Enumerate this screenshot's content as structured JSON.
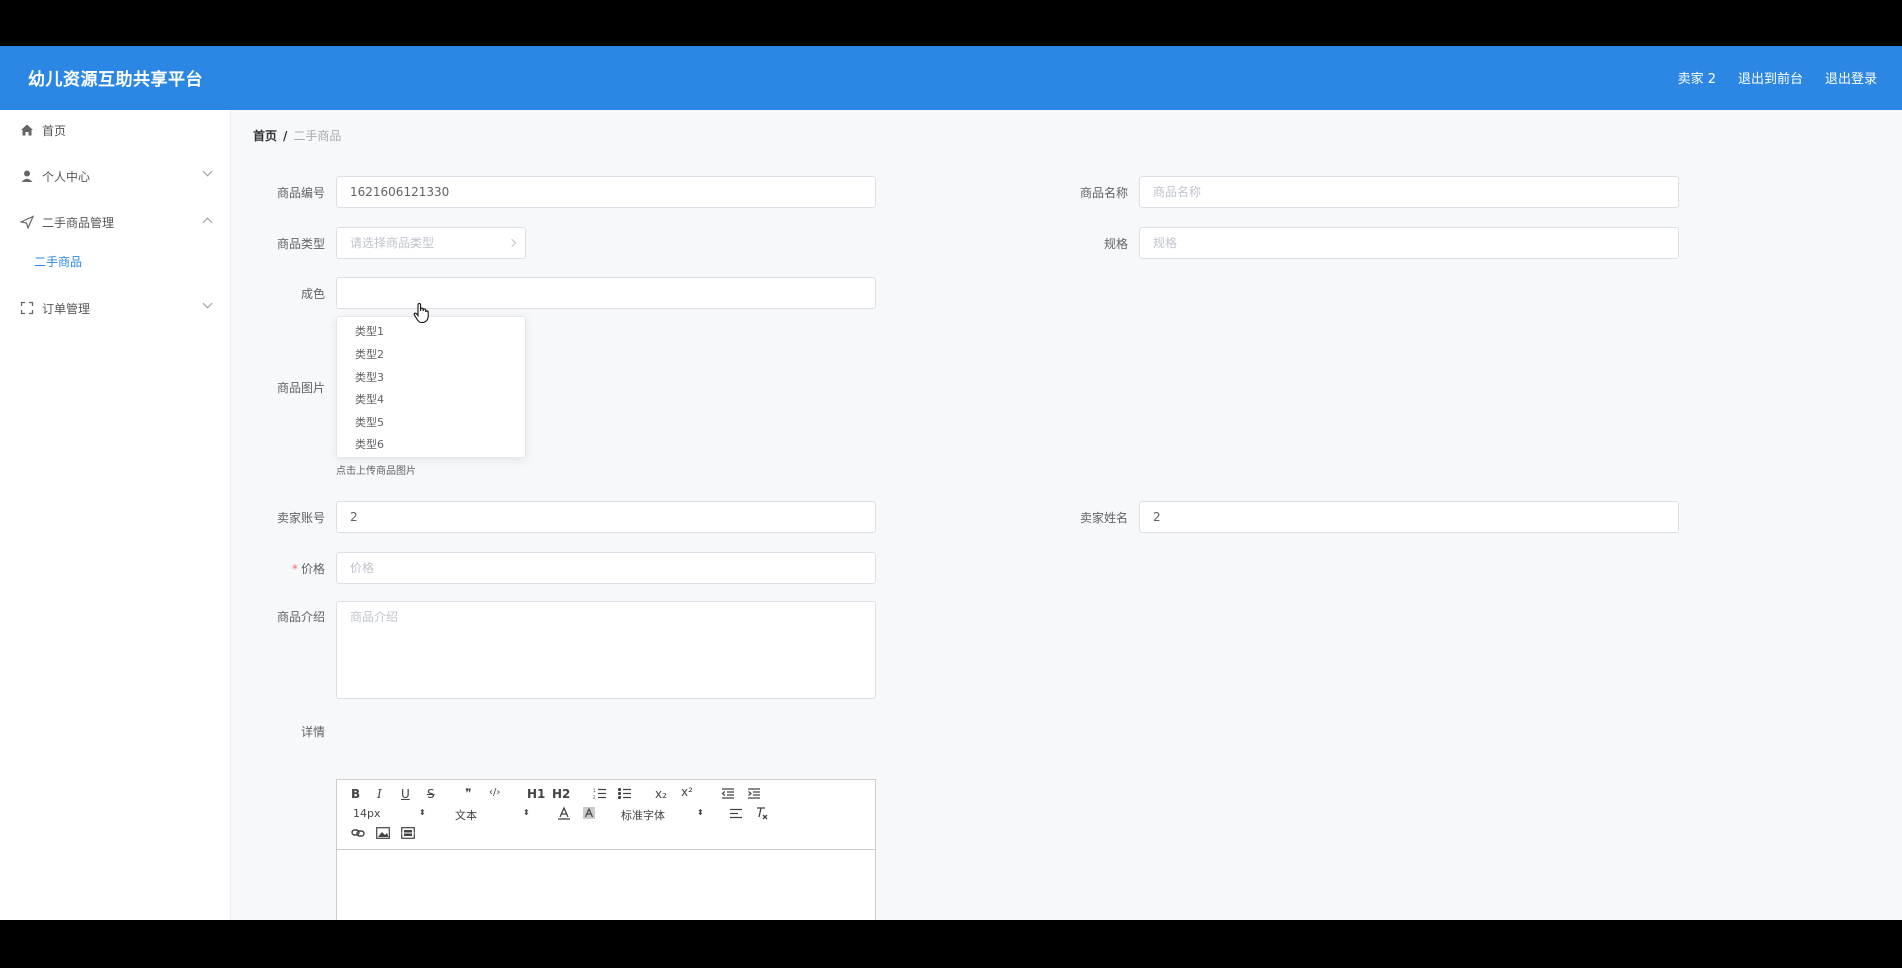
{
  "header": {
    "title": "幼儿资源互助共享平台",
    "user": "卖家 2",
    "to_front": "退出到前台",
    "logout": "退出登录"
  },
  "sidebar": {
    "items": [
      {
        "label": "首页",
        "icon": "home-icon"
      },
      {
        "label": "个人中心",
        "icon": "user-icon"
      },
      {
        "label": "二手商品管理",
        "icon": "send-icon"
      },
      {
        "label": "订单管理",
        "icon": "fullscreen-icon"
      }
    ],
    "sub_item": "二手商品"
  },
  "breadcrumb": {
    "home": "首页",
    "sep": "/",
    "current": "二手商品"
  },
  "form": {
    "product_no_label": "商品编号",
    "product_no_value": "1621606121330",
    "product_name_label": "商品名称",
    "product_name_placeholder": "商品名称",
    "product_type_label": "商品类型",
    "product_type_placeholder": "请选择商品类型",
    "spec_label": "规格",
    "spec_placeholder": "规格",
    "condition_label": "成色",
    "image_label": "商品图片",
    "upload_tip": "点击上传商品图片",
    "seller_account_label": "卖家账号",
    "seller_account_value": "2",
    "seller_name_label": "卖家姓名",
    "seller_name_value": "2",
    "price_required": "*",
    "price_label": "价格",
    "price_placeholder": "价格",
    "intro_label": "商品介绍",
    "intro_placeholder": "商品介绍",
    "detail_label": "详情"
  },
  "dropdown": {
    "options": [
      "类型1",
      "类型2",
      "类型3",
      "类型4",
      "类型5",
      "类型6"
    ]
  },
  "editor": {
    "bold": "B",
    "italic": "I",
    "underline": "U",
    "strike": "S",
    "quote": "❞",
    "code": "‹/›",
    "h1": "H1",
    "h2": "H2",
    "sub": "x₂",
    "sup": "x²",
    "font_size": "14px",
    "header_select": "文本",
    "font_family": "标准字体"
  },
  "colors": {
    "header_bg": "#2b87e3",
    "accent": "#2b87e3"
  }
}
